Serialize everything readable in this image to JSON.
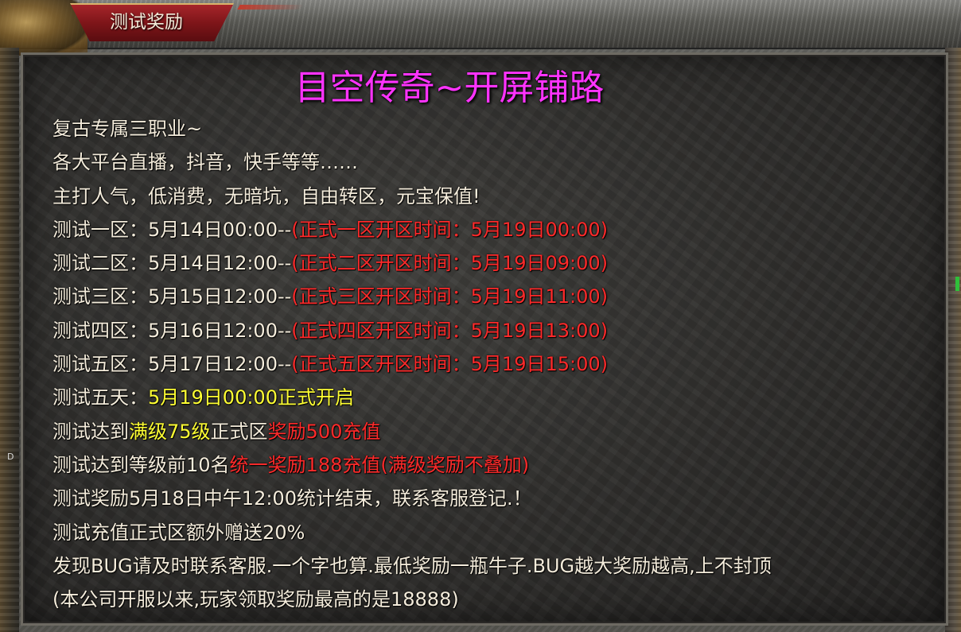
{
  "window": {
    "tab_title": "测试奖励",
    "edge_letter": "D"
  },
  "content": {
    "heading": "目空传奇~开屏铺路",
    "lines": [
      {
        "segments": [
          {
            "text": "复古专属三职业~",
            "color": "white"
          }
        ]
      },
      {
        "segments": [
          {
            "text": "各大平台直播，抖音，快手等等……",
            "color": "white"
          }
        ]
      },
      {
        "segments": [
          {
            "text": "主打人气，低消费，无暗坑，自由转区，元宝保值!",
            "color": "white"
          }
        ]
      },
      {
        "segments": [
          {
            "text": "测试一区：5月14日00:00--",
            "color": "white"
          },
          {
            "text": "(正式一区开区时间：5月19日00:00)",
            "color": "red"
          }
        ]
      },
      {
        "segments": [
          {
            "text": "测试二区：5月14日12:00--",
            "color": "white"
          },
          {
            "text": "(正式二区开区时间：5月19日09:00)",
            "color": "red"
          }
        ]
      },
      {
        "segments": [
          {
            "text": "测试三区：5月15日12:00--",
            "color": "white"
          },
          {
            "text": "(正式三区开区时间：5月19日11:00)",
            "color": "red"
          }
        ]
      },
      {
        "segments": [
          {
            "text": "测试四区：5月16日12:00--",
            "color": "white"
          },
          {
            "text": "(正式四区开区时间：5月19日13:00)",
            "color": "red"
          }
        ]
      },
      {
        "segments": [
          {
            "text": "测试五区：5月17日12:00--",
            "color": "white"
          },
          {
            "text": "(正式五区开区时间：5月19日15:00)",
            "color": "red"
          }
        ]
      },
      {
        "segments": [
          {
            "text": "测试五天：",
            "color": "white"
          },
          {
            "text": "5月19日00:00正式开启",
            "color": "yellow"
          }
        ]
      },
      {
        "segments": [
          {
            "text": "测试达到",
            "color": "white"
          },
          {
            "text": "满级75级",
            "color": "yellow"
          },
          {
            "text": "正式区",
            "color": "white"
          },
          {
            "text": "奖励500充值",
            "color": "red"
          }
        ]
      },
      {
        "segments": [
          {
            "text": "测试达到等级前10名",
            "color": "white"
          },
          {
            "text": "统一奖励188充值(满级奖励不叠加)",
            "color": "red"
          }
        ]
      },
      {
        "segments": [
          {
            "text": "测试奖励5月18日中午12:00统计结束，联系客服登记.！",
            "color": "white"
          }
        ]
      },
      {
        "segments": [
          {
            "text": "测试充值正式区额外赠送20%",
            "color": "white"
          }
        ]
      },
      {
        "segments": [
          {
            "text": "发现BUG请及时联系客服.一个字也算.最低奖励一瓶牛子.BUG越大奖励越高,上不封顶",
            "color": "white"
          }
        ]
      },
      {
        "segments": [
          {
            "text": "(本公司开服以来,玩家领取奖励最高的是18888)",
            "color": "white"
          }
        ]
      }
    ]
  },
  "colors": {
    "heading": "#ff33ff",
    "white": "#f4ecdb",
    "red": "#ff2a2a",
    "yellow": "#ffff33",
    "tab": "#8a1a1e"
  }
}
